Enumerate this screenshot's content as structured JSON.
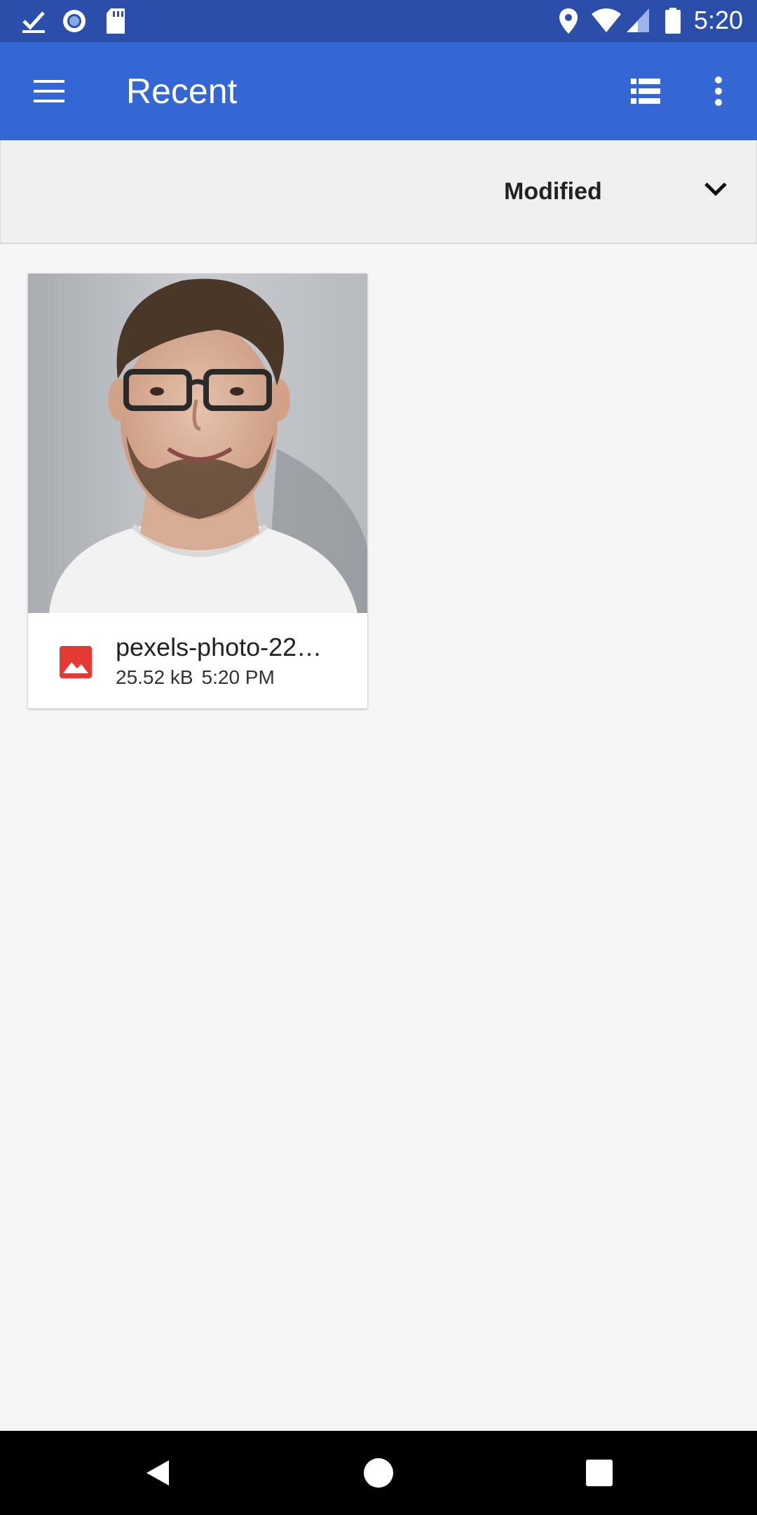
{
  "status_bar": {
    "time": "5:20",
    "icons": [
      "download-done-icon",
      "sync-circle-icon",
      "sd-card-icon",
      "location-icon",
      "wifi-icon",
      "signal-icon",
      "battery-icon"
    ]
  },
  "app_bar": {
    "title": "Recent",
    "color": "#3467d4",
    "icons": [
      "menu-icon",
      "list-view-icon",
      "more-vert-icon"
    ]
  },
  "sort_bar": {
    "label": "Modified",
    "icon": "chevron-down-icon"
  },
  "files": [
    {
      "name": "pexels-photo-22…",
      "size": "25.52 kB",
      "time": "5:20 PM",
      "type_icon": "image-file-icon",
      "type_color": "#e53935"
    }
  ],
  "nav_bar": {
    "icons": [
      "back-icon",
      "home-icon",
      "recents-icon"
    ]
  }
}
